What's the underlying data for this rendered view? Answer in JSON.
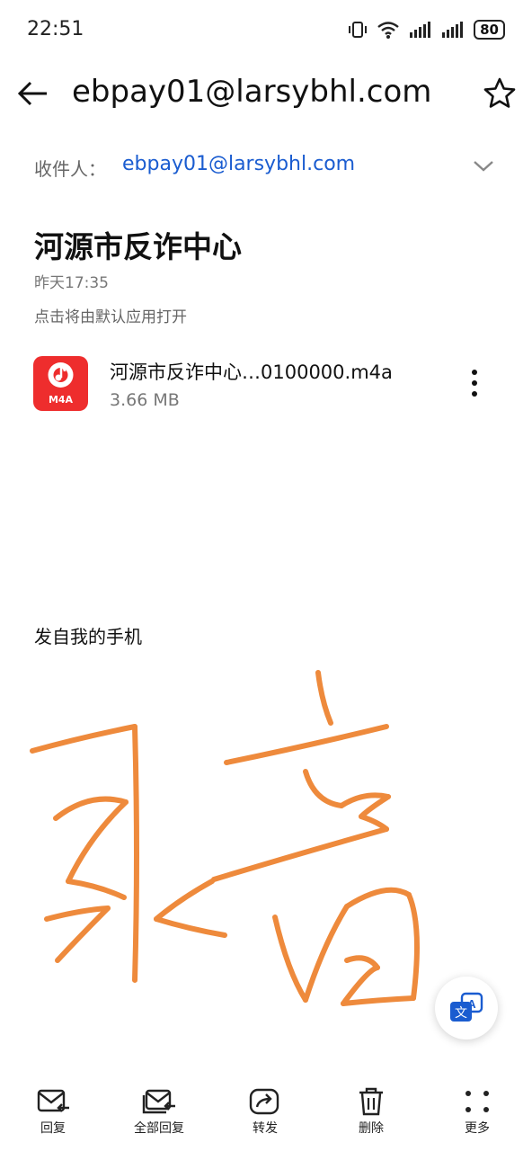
{
  "status_bar": {
    "time": "22:51",
    "battery": "80"
  },
  "header": {
    "title": "ebpay01@larsybhl.com"
  },
  "recipient": {
    "label": "收件人：",
    "address": "ebpay01@larsybhl.com"
  },
  "email": {
    "subject": "河源市反诈中心",
    "date": "昨天17:35",
    "open_hint": "点击将由默认应用打开",
    "signature": "发自我的手机"
  },
  "attachment": {
    "type_label": "M4A",
    "name": "河源市反诈中心…0100000.m4a",
    "size": "3.66 MB",
    "accent_color": "#ee2d2d"
  },
  "drawing": {
    "stroke_color": "#ee8a3c",
    "description_icon": "handwritten-drawing"
  },
  "toolbar": {
    "reply": "回复",
    "reply_all": "全部回复",
    "forward": "转发",
    "delete": "删除",
    "more": "更多"
  },
  "icons": [
    "back-arrow-icon",
    "star-icon",
    "chevron-down-icon",
    "music-note-icon",
    "more-vertical-icon",
    "translate-icon",
    "reply-icon",
    "reply-all-icon",
    "forward-icon",
    "trash-icon",
    "more-grid-icon"
  ]
}
